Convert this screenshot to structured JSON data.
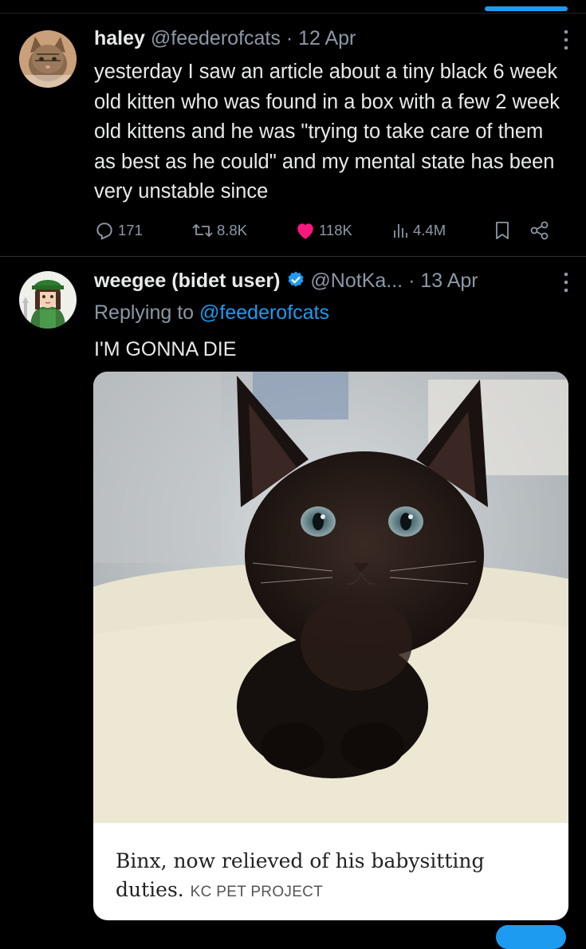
{
  "tweets": [
    {
      "name": "haley",
      "handle": "@feederofcats",
      "separator": "·",
      "date": "12 Apr",
      "text": "yesterday I saw an article about a tiny black 6 week old kitten who was found in a box with a few 2 week old kittens and he was \"trying to take care of them as best as he could\" and my mental state has been very unstable since",
      "stats": {
        "replies": "171",
        "retweets": "8.8K",
        "likes": "118K",
        "views": "4.4M"
      }
    },
    {
      "name": "weegee (bidet user)",
      "handle": "@NotKa...",
      "separator": "·",
      "date": "13 Apr",
      "replying_prefix": "Replying to",
      "replying_to": "@feederofcats",
      "text": "I'M GONNA DIE",
      "card": {
        "caption": "Binx, now relieved of his babysitting duties.",
        "credit": "KC PET PROJECT"
      }
    }
  ],
  "colors": {
    "accent": "#1d9bf0",
    "like": "#f91880",
    "muted": "#8b98a5",
    "text": "#e7e9ea",
    "background": "#000000"
  },
  "icons": [
    "reply-icon",
    "retweet-icon",
    "heart-icon",
    "views-icon",
    "bookmark-icon",
    "share-icon",
    "more-icon",
    "verified-icon"
  ]
}
